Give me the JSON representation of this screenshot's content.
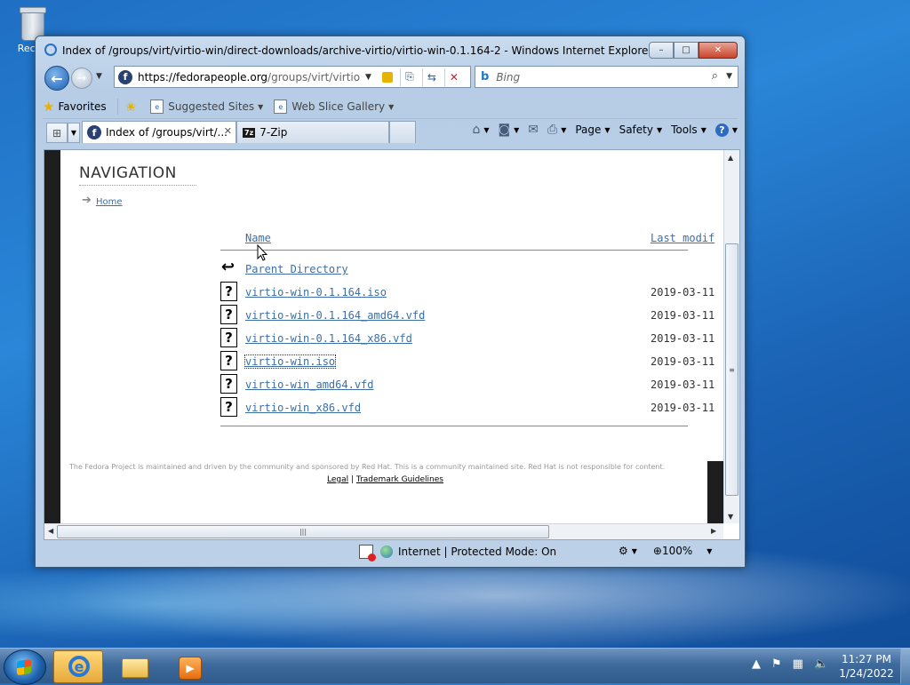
{
  "desktop": {
    "recycle_bin_label": "Recyc"
  },
  "window": {
    "title": "Index of /groups/virt/virtio-win/direct-downloads/archive-virtio/virtio-win-0.1.164-2 - Windows Internet Explorer",
    "buttons": {
      "minimize": "–",
      "maximize": "□",
      "close": "✕"
    }
  },
  "address": {
    "url_host": "https://fedorapeople.org",
    "url_path": "/groups/virt/virtio-wir"
  },
  "search": {
    "placeholder": "Bing"
  },
  "favorites_bar": {
    "favorites_label": "Favorites",
    "suggested_sites_label": "Suggested Sites",
    "web_slice_gallery_label": "Web Slice Gallery"
  },
  "tabs": [
    {
      "label": "Index of /groups/virt/...",
      "active": true
    },
    {
      "label": "7-Zip",
      "active": false
    }
  ],
  "command_bar": {
    "page_label": "Page",
    "safety_label": "Safety",
    "tools_label": "Tools"
  },
  "page": {
    "nav_heading": "NAVIGATION",
    "home_link": "Home",
    "columns": {
      "name": "Name",
      "last_modified": "Last modif"
    },
    "parent_directory": "Parent Directory",
    "files": [
      {
        "name": "virtio-win-0.1.164.iso",
        "date": "2019-03-11"
      },
      {
        "name": "virtio-win-0.1.164_amd64.vfd",
        "date": "2019-03-11"
      },
      {
        "name": "virtio-win-0.1.164_x86.vfd",
        "date": "2019-03-11"
      },
      {
        "name": "virtio-win.iso",
        "date": "2019-03-11"
      },
      {
        "name": "virtio-win_amd64.vfd",
        "date": "2019-03-11"
      },
      {
        "name": "virtio-win_x86.vfd",
        "date": "2019-03-11"
      }
    ],
    "footer_text": "The Fedora Project is maintained and driven by the community and sponsored by Red Hat. This is a community maintained site. Red Hat is not responsible for content.",
    "footer_links": {
      "legal": "Legal",
      "separator": "|",
      "trademark": "Trademark Guidelines"
    }
  },
  "status_bar": {
    "zone": "Internet | Protected Mode: On",
    "zoom": "100%"
  },
  "taskbar": {
    "time": "11:27 PM",
    "date": "1/24/2022"
  }
}
